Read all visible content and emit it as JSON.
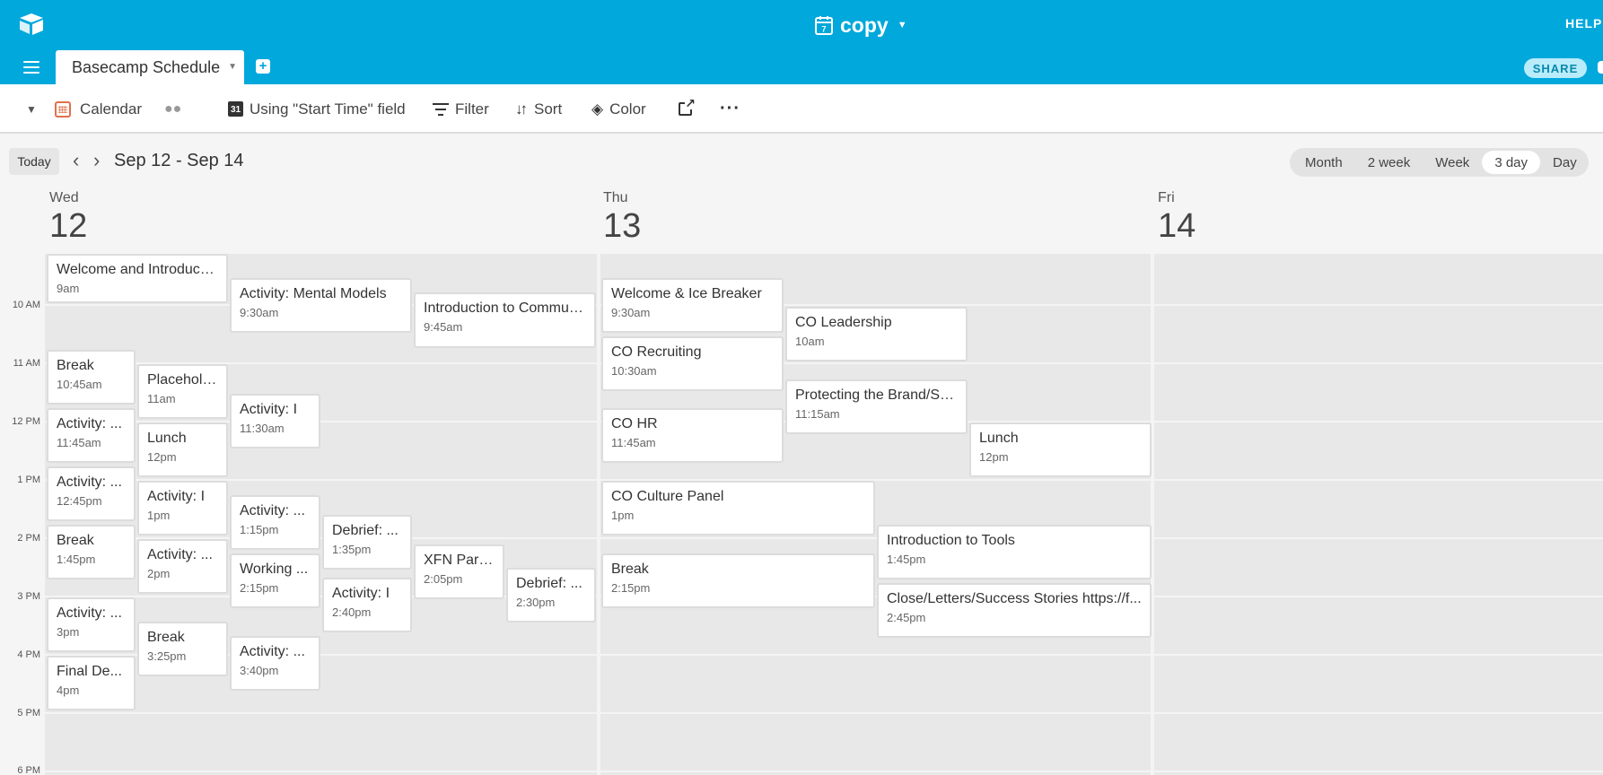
{
  "header": {
    "base_name": "copy",
    "help_label": "HELP",
    "table_tab": "Basecamp Schedule",
    "add_tab_label": "+",
    "share_label": "SHARE"
  },
  "toolbar": {
    "view_name": "Calendar",
    "date_field": "Using \"Start Time\" field",
    "date_field_icon_text": "31",
    "filter_label": "Filter",
    "sort_label": "Sort",
    "color_label": "Color",
    "more_label": "···"
  },
  "nav": {
    "today_label": "Today",
    "date_range": "Sep 12 - Sep 14",
    "view_modes": [
      "Month",
      "2 week",
      "Week",
      "3 day",
      "Day"
    ],
    "active_mode": "3 day"
  },
  "days": [
    {
      "name": "Wed",
      "number": "12"
    },
    {
      "name": "Thu",
      "number": "13"
    },
    {
      "name": "Fri",
      "number": "14"
    }
  ],
  "time_labels": [
    "10 AM",
    "11 AM",
    "12 PM",
    "1 PM",
    "2 PM",
    "3 PM",
    "4 PM",
    "5 PM",
    "6 PM"
  ],
  "events": {
    "wed": [
      {
        "title": "Welcome and Introductions",
        "time": "9am"
      },
      {
        "title": "Activity: Mental Models",
        "time": "9:30am"
      },
      {
        "title": "Introduction to Communication",
        "time": "9:45am"
      },
      {
        "title": "Break",
        "time": "10:45am"
      },
      {
        "title": "Placeholder",
        "time": "11am"
      },
      {
        "title": "Activity: I",
        "time": "11:30am"
      },
      {
        "title": "Activity: ...",
        "time": "11:45am"
      },
      {
        "title": "Lunch",
        "time": "12pm"
      },
      {
        "title": "Activity: ...",
        "time": "12:45pm"
      },
      {
        "title": "Activity: I",
        "time": "1pm"
      },
      {
        "title": "Activity: ...",
        "time": "1:15pm"
      },
      {
        "title": "Debrief: ...",
        "time": "1:35pm"
      },
      {
        "title": "Break",
        "time": "1:45pm"
      },
      {
        "title": "Activity: ...",
        "time": "2pm"
      },
      {
        "title": "XFN Part...",
        "time": "2:05pm"
      },
      {
        "title": "Working ...",
        "time": "2:15pm"
      },
      {
        "title": "Debrief: ...",
        "time": "2:30pm"
      },
      {
        "title": "Activity: I",
        "time": "2:40pm"
      },
      {
        "title": "Activity: ...",
        "time": "3pm"
      },
      {
        "title": "Break",
        "time": "3:25pm"
      },
      {
        "title": "Activity: ...",
        "time": "3:40pm"
      },
      {
        "title": "Final De...",
        "time": "4pm"
      }
    ],
    "thu": [
      {
        "title": "Welcome & Ice Breaker",
        "time": "9:30am"
      },
      {
        "title": "CO Leadership",
        "time": "10am"
      },
      {
        "title": "CO Recruiting",
        "time": "10:30am"
      },
      {
        "title": "Protecting the Brand/Security",
        "time": "11:15am"
      },
      {
        "title": "CO HR",
        "time": "11:45am"
      },
      {
        "title": "Lunch",
        "time": "12pm"
      },
      {
        "title": "CO Culture Panel",
        "time": "1pm"
      },
      {
        "title": "Introduction to Tools",
        "time": "1:45pm"
      },
      {
        "title": "Break",
        "time": "2:15pm"
      },
      {
        "title": "Close/Letters/Success Stories https://f...",
        "time": "2:45pm"
      }
    ]
  }
}
